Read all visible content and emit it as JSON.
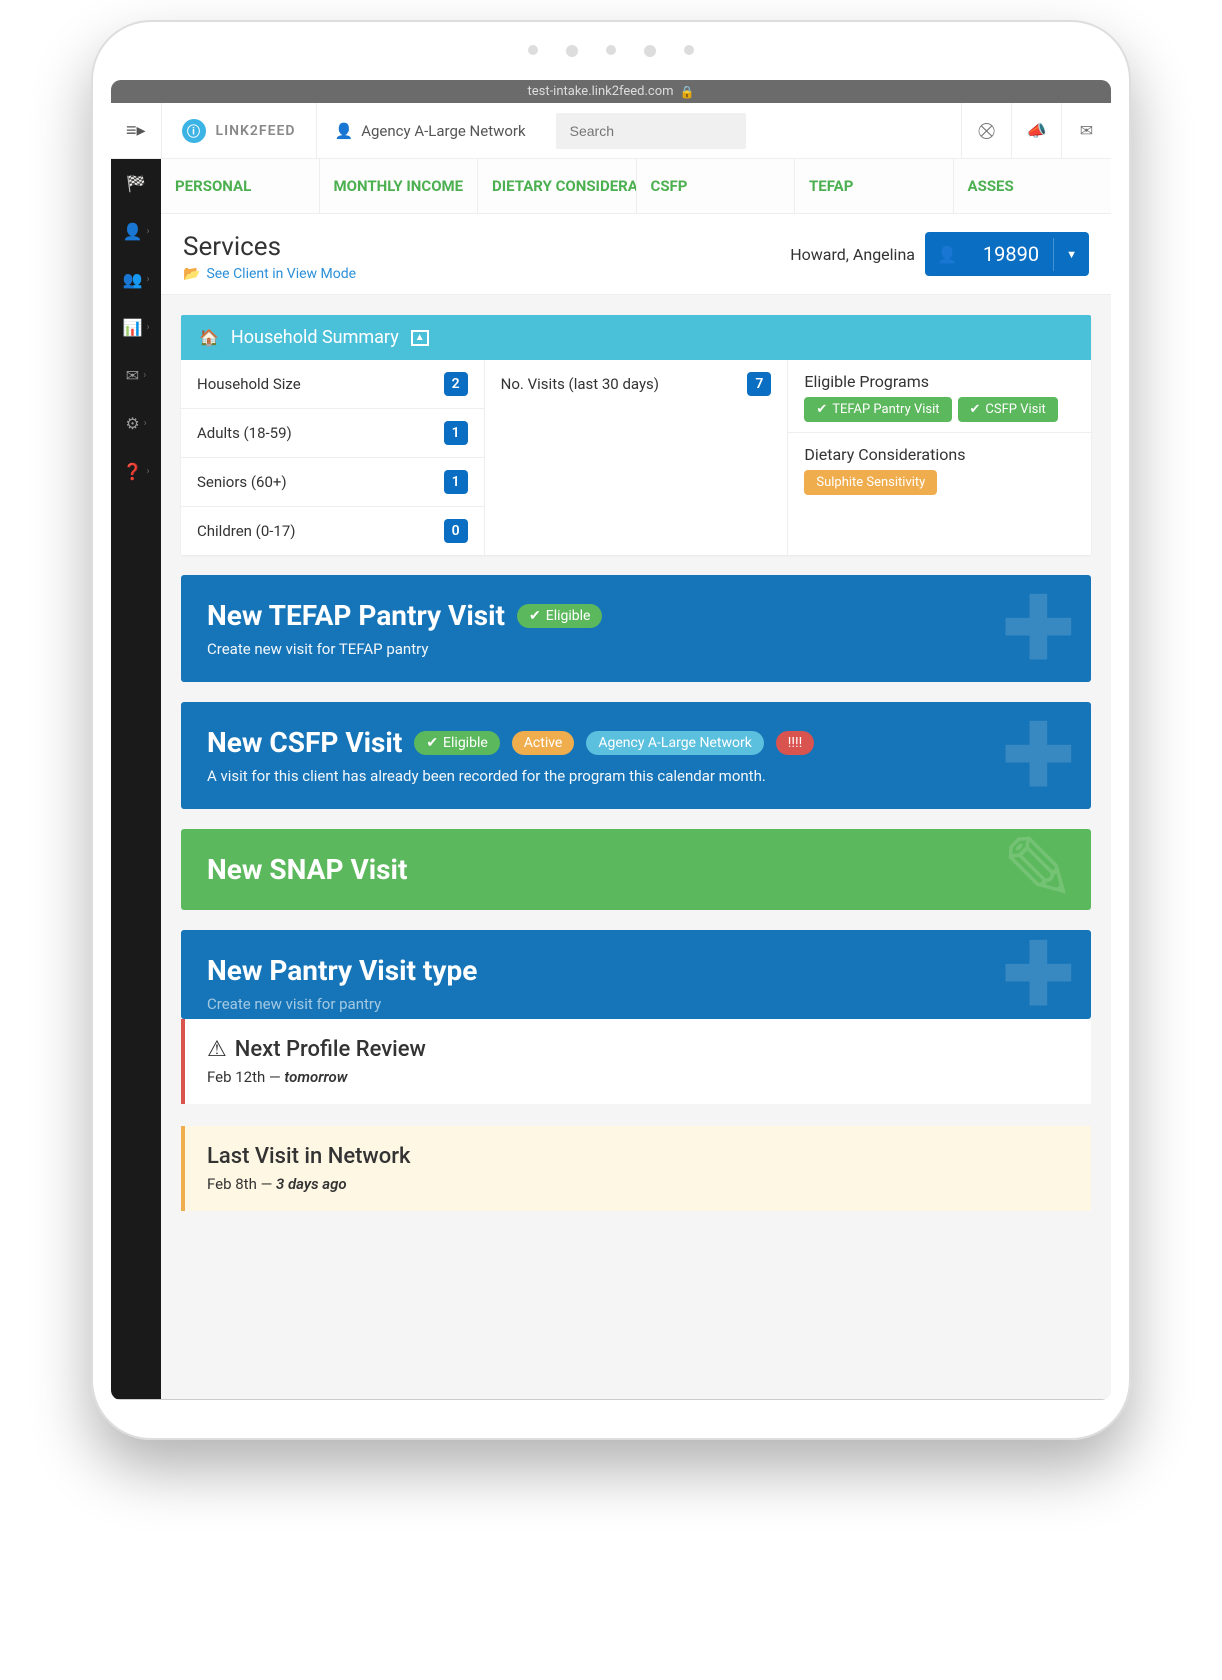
{
  "url": "test-intake.link2feed.com",
  "brand": "LINK2FEED",
  "agency": "Agency A-Large Network",
  "search": {
    "placeholder": "Search"
  },
  "tabs": [
    "PERSONAL",
    "MONTHLY INCOME",
    "DIETARY CONSIDERATIO…",
    "CSFP",
    "TEFAP",
    "ASSES"
  ],
  "page": {
    "title": "Services",
    "view_mode_link": "See Client in View Mode",
    "client_name": "Howard, Angelina",
    "client_id": "19890"
  },
  "household_summary": {
    "header": "Household Summary",
    "left": [
      {
        "label": "Household Size",
        "value": "2"
      },
      {
        "label": "Adults (18-59)",
        "value": "1"
      },
      {
        "label": "Seniors (60+)",
        "value": "1"
      },
      {
        "label": "Children (0-17)",
        "value": "0"
      }
    ],
    "mid": {
      "label": "No. Visits (last 30 days)",
      "value": "7"
    },
    "right": {
      "eligible_title": "Eligible Programs",
      "eligible": [
        "TEFAP Pantry Visit",
        "CSFP Visit"
      ],
      "dietary_title": "Dietary Considerations",
      "dietary": [
        "Sulphite Sensitivity"
      ]
    }
  },
  "visit_cards": {
    "tefap": {
      "title": "New TEFAP Pantry Visit",
      "badge": "Eligible",
      "subtitle": "Create new visit for TEFAP pantry"
    },
    "csfp": {
      "title": "New CSFP Visit",
      "badges": {
        "eligible": "Eligible",
        "active": "Active",
        "agency": "Agency A-Large Network",
        "warn": "!!!!"
      },
      "subtitle": "A visit for this client has already been recorded for the program this calendar month."
    },
    "snap": {
      "title": "New SNAP Visit"
    },
    "pantry": {
      "title": "New Pantry Visit type",
      "subtitle": "Create new visit for pantry"
    }
  },
  "alerts": {
    "review": {
      "title": "Next Profile Review",
      "date": "Feb 12th",
      "relative": "tomorrow"
    },
    "last_visit": {
      "title": "Last Visit in Network",
      "date": "Feb 8th",
      "relative": "3 days ago"
    }
  }
}
